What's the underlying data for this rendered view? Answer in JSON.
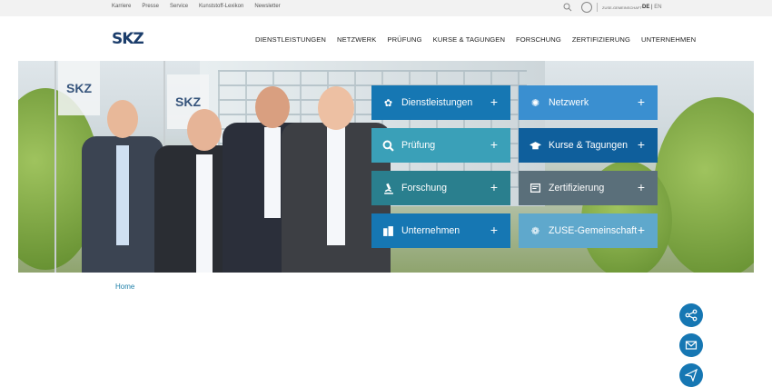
{
  "topbar": {
    "links": [
      "Karriere",
      "Presse",
      "Service",
      "Kunststoff-Lexikon",
      "Newsletter"
    ],
    "zuse_label": "ZUSE-GEMEINSCHAFT",
    "lang_de": "DE",
    "lang_sep": "|",
    "lang_en": "EN"
  },
  "header": {
    "brand": "SKZ",
    "nav": [
      "DIENSTLEISTUNGEN",
      "NETZWERK",
      "PRÜFUNG",
      "KURSE & TAGUNGEN",
      "FORSCHUNG",
      "ZERTIFIZIERUNG",
      "UNTERNEHMEN"
    ]
  },
  "hero": {
    "flag_text": "SKZ",
    "tiles": [
      {
        "label": "Dienstleistungen",
        "icon": "handshake-icon",
        "color": "#1677b3"
      },
      {
        "label": "Netzwerk",
        "icon": "network-icon",
        "color": "#3a8fd0"
      },
      {
        "label": "Prüfung",
        "icon": "magnifier-icon",
        "color": "#3aa0b8"
      },
      {
        "label": "Kurse & Tagungen",
        "icon": "graduation-cap-icon",
        "color": "#0f5f9c"
      },
      {
        "label": "Forschung",
        "icon": "microscope-icon",
        "color": "#2a7f8e"
      },
      {
        "label": "Zertifizierung",
        "icon": "certificate-icon",
        "color": "#5a6f7a"
      },
      {
        "label": "Unternehmen",
        "icon": "building-icon",
        "color": "#1677b3"
      },
      {
        "label": "ZUSE-Gemeinschaft",
        "icon": "zuse-icon",
        "color": "#5fa8cc"
      }
    ],
    "plus": "+"
  },
  "breadcrumb": {
    "home": "Home"
  },
  "fabs": [
    "share-icon",
    "mail-icon",
    "paper-plane-icon"
  ]
}
